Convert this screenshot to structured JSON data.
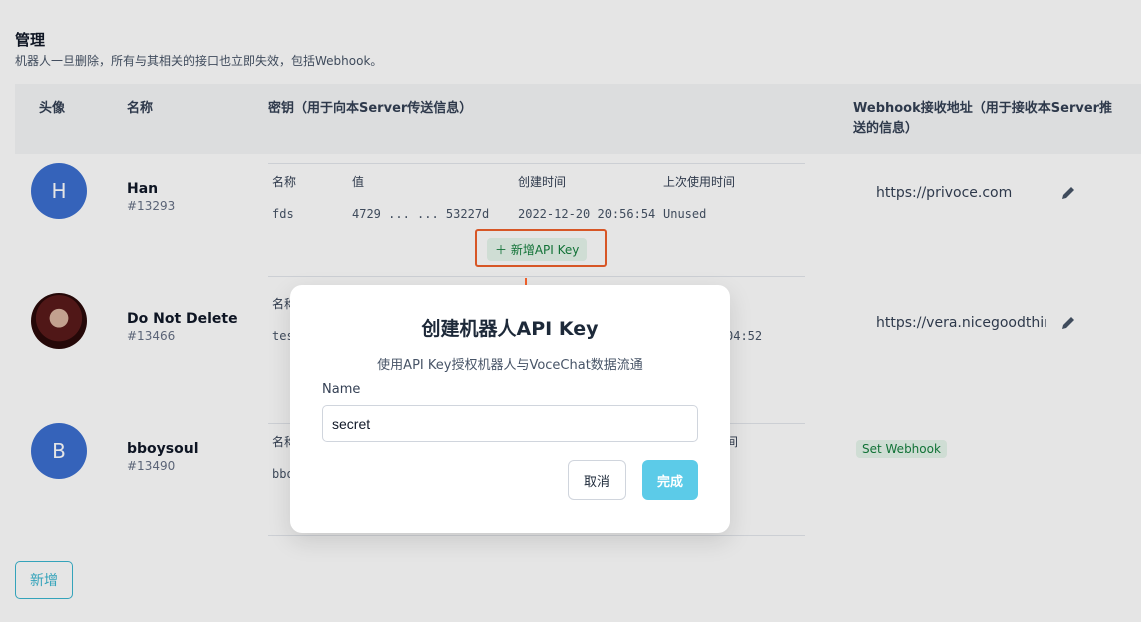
{
  "header": {
    "title": "管理",
    "subtitle": "机器人一旦删除，所有与其相关的接口也立即失效，包括Webhook。"
  },
  "table": {
    "columns": [
      "头像",
      "名称",
      "密钥（用于向本Server传送信息）",
      "Webhook接收地址（用于接收本Server推送的信息）"
    ],
    "key_columns": [
      "名称",
      "值",
      "创建时间",
      "上次使用时间"
    ],
    "rows": [
      {
        "avatar_letter": "H",
        "name": "Han",
        "uid": "#13293",
        "key": {
          "name": "fds",
          "value": "4729 ... ... 53227d",
          "created": "2022-12-20 20:56:54",
          "last_used": "Unused"
        },
        "webhook": "https://privoce.com"
      },
      {
        "avatar_letter": "",
        "name": "Do Not Delete",
        "uid": "#13466",
        "key_partial_name": "名称",
        "key_partial_value": "tes",
        "key_partial_time": "04:52",
        "webhook": "https://vera.nicegoodthin"
      },
      {
        "avatar_letter": "B",
        "name": "bboysoul",
        "uid": "#13490",
        "key_partial_name": "名称",
        "key_partial_value": "bbo",
        "key_partial_time": "间",
        "webhook_action": "Set Webhook"
      }
    ],
    "add_key_label": "新增API Key",
    "add_key_icon": "plus-icon"
  },
  "new_button": "新增",
  "modal": {
    "title": "创建机器人API Key",
    "description": "使用API Key授权机器人与VoceChat数据流通",
    "field_label": "Name",
    "field_value": "secret",
    "cancel": "取消",
    "confirm": "完成"
  },
  "colors": {
    "accent": "#5ccbe8",
    "highlight": "#f0602b",
    "avatar_blue": "#3b6fd0",
    "green": "#137f3d"
  }
}
